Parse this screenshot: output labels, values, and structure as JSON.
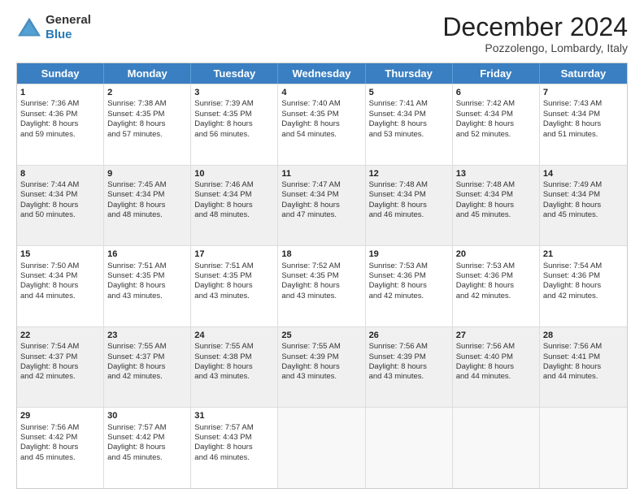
{
  "header": {
    "logo_line1": "General",
    "logo_line2": "Blue",
    "month": "December 2024",
    "location": "Pozzolengo, Lombardy, Italy"
  },
  "days": [
    "Sunday",
    "Monday",
    "Tuesday",
    "Wednesday",
    "Thursday",
    "Friday",
    "Saturday"
  ],
  "rows": [
    [
      {
        "day": "",
        "info": "",
        "empty": true
      },
      {
        "day": "2",
        "info": "Sunrise: 7:38 AM\nSunset: 4:35 PM\nDaylight: 8 hours\nand 57 minutes."
      },
      {
        "day": "3",
        "info": "Sunrise: 7:39 AM\nSunset: 4:35 PM\nDaylight: 8 hours\nand 56 minutes."
      },
      {
        "day": "4",
        "info": "Sunrise: 7:40 AM\nSunset: 4:35 PM\nDaylight: 8 hours\nand 54 minutes."
      },
      {
        "day": "5",
        "info": "Sunrise: 7:41 AM\nSunset: 4:34 PM\nDaylight: 8 hours\nand 53 minutes."
      },
      {
        "day": "6",
        "info": "Sunrise: 7:42 AM\nSunset: 4:34 PM\nDaylight: 8 hours\nand 52 minutes."
      },
      {
        "day": "7",
        "info": "Sunrise: 7:43 AM\nSunset: 4:34 PM\nDaylight: 8 hours\nand 51 minutes."
      }
    ],
    [
      {
        "day": "8",
        "info": "Sunrise: 7:44 AM\nSunset: 4:34 PM\nDaylight: 8 hours\nand 50 minutes."
      },
      {
        "day": "9",
        "info": "Sunrise: 7:45 AM\nSunset: 4:34 PM\nDaylight: 8 hours\nand 48 minutes."
      },
      {
        "day": "10",
        "info": "Sunrise: 7:46 AM\nSunset: 4:34 PM\nDaylight: 8 hours\nand 48 minutes."
      },
      {
        "day": "11",
        "info": "Sunrise: 7:47 AM\nSunset: 4:34 PM\nDaylight: 8 hours\nand 47 minutes."
      },
      {
        "day": "12",
        "info": "Sunrise: 7:48 AM\nSunset: 4:34 PM\nDaylight: 8 hours\nand 46 minutes."
      },
      {
        "day": "13",
        "info": "Sunrise: 7:48 AM\nSunset: 4:34 PM\nDaylight: 8 hours\nand 45 minutes."
      },
      {
        "day": "14",
        "info": "Sunrise: 7:49 AM\nSunset: 4:34 PM\nDaylight: 8 hours\nand 45 minutes."
      }
    ],
    [
      {
        "day": "15",
        "info": "Sunrise: 7:50 AM\nSunset: 4:34 PM\nDaylight: 8 hours\nand 44 minutes."
      },
      {
        "day": "16",
        "info": "Sunrise: 7:51 AM\nSunset: 4:35 PM\nDaylight: 8 hours\nand 43 minutes."
      },
      {
        "day": "17",
        "info": "Sunrise: 7:51 AM\nSunset: 4:35 PM\nDaylight: 8 hours\nand 43 minutes."
      },
      {
        "day": "18",
        "info": "Sunrise: 7:52 AM\nSunset: 4:35 PM\nDaylight: 8 hours\nand 43 minutes."
      },
      {
        "day": "19",
        "info": "Sunrise: 7:53 AM\nSunset: 4:36 PM\nDaylight: 8 hours\nand 42 minutes."
      },
      {
        "day": "20",
        "info": "Sunrise: 7:53 AM\nSunset: 4:36 PM\nDaylight: 8 hours\nand 42 minutes."
      },
      {
        "day": "21",
        "info": "Sunrise: 7:54 AM\nSunset: 4:36 PM\nDaylight: 8 hours\nand 42 minutes."
      }
    ],
    [
      {
        "day": "22",
        "info": "Sunrise: 7:54 AM\nSunset: 4:37 PM\nDaylight: 8 hours\nand 42 minutes."
      },
      {
        "day": "23",
        "info": "Sunrise: 7:55 AM\nSunset: 4:37 PM\nDaylight: 8 hours\nand 42 minutes."
      },
      {
        "day": "24",
        "info": "Sunrise: 7:55 AM\nSunset: 4:38 PM\nDaylight: 8 hours\nand 43 minutes."
      },
      {
        "day": "25",
        "info": "Sunrise: 7:55 AM\nSunset: 4:39 PM\nDaylight: 8 hours\nand 43 minutes."
      },
      {
        "day": "26",
        "info": "Sunrise: 7:56 AM\nSunset: 4:39 PM\nDaylight: 8 hours\nand 43 minutes."
      },
      {
        "day": "27",
        "info": "Sunrise: 7:56 AM\nSunset: 4:40 PM\nDaylight: 8 hours\nand 44 minutes."
      },
      {
        "day": "28",
        "info": "Sunrise: 7:56 AM\nSunset: 4:41 PM\nDaylight: 8 hours\nand 44 minutes."
      }
    ],
    [
      {
        "day": "29",
        "info": "Sunrise: 7:56 AM\nSunset: 4:42 PM\nDaylight: 8 hours\nand 45 minutes."
      },
      {
        "day": "30",
        "info": "Sunrise: 7:57 AM\nSunset: 4:42 PM\nDaylight: 8 hours\nand 45 minutes."
      },
      {
        "day": "31",
        "info": "Sunrise: 7:57 AM\nSunset: 4:43 PM\nDaylight: 8 hours\nand 46 minutes."
      },
      {
        "day": "",
        "info": "",
        "empty": true
      },
      {
        "day": "",
        "info": "",
        "empty": true
      },
      {
        "day": "",
        "info": "",
        "empty": true
      },
      {
        "day": "",
        "info": "",
        "empty": true
      }
    ]
  ],
  "row0_sunday": {
    "day": "1",
    "info": "Sunrise: 7:36 AM\nSunset: 4:36 PM\nDaylight: 8 hours\nand 59 minutes."
  }
}
